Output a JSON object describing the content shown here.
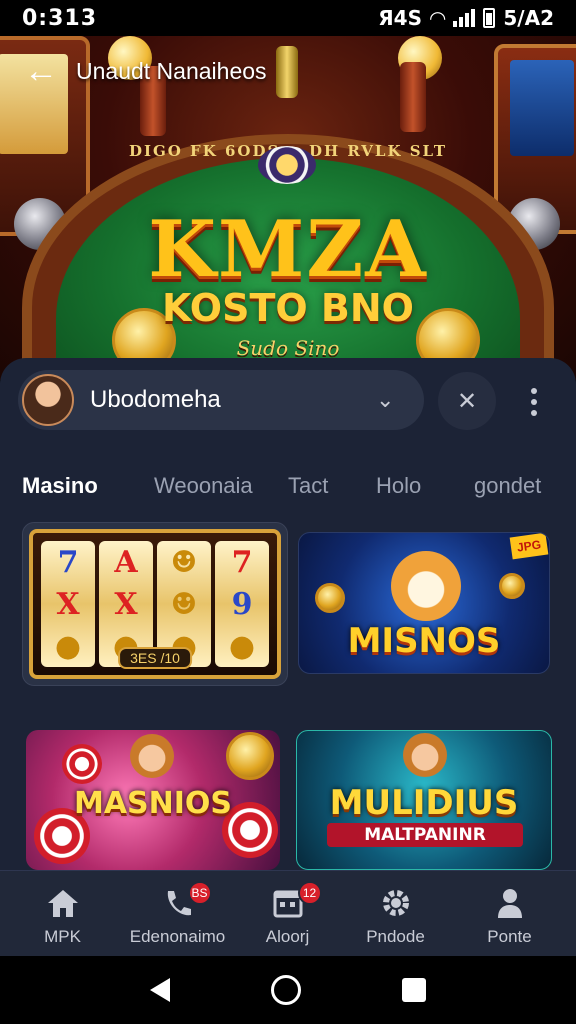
{
  "status_bar": {
    "time": "0:313",
    "right_text": "Я4Ѕ",
    "battery_text": "5/A2"
  },
  "header": {
    "title": "Unaudt Nanaiheos"
  },
  "hero": {
    "table_text": "DIGO FK 6ODS  ∨  DH RVLK SLT",
    "logo_main": "KMZA",
    "logo_sub": "KOSTO BNO",
    "logo_tag": "Sudo Sino"
  },
  "search": {
    "value": "Ubodomeha"
  },
  "tabs": [
    {
      "label": "Masino",
      "active": true
    },
    {
      "label": "Weoonaia",
      "active": false
    },
    {
      "label": "Tact",
      "active": false
    },
    {
      "label": "Holo",
      "active": false
    },
    {
      "label": "gondet",
      "active": false
    }
  ],
  "cards": {
    "slots": {
      "reels": [
        [
          "7",
          "X",
          ""
        ],
        [
          "A",
          "X",
          ""
        ],
        [
          "",
          "",
          ""
        ],
        [
          "7",
          "9",
          ""
        ]
      ],
      "label": "3ES /10"
    },
    "misnos": {
      "title": "MISNOS",
      "corner": "JPG"
    },
    "masnios": {
      "title": "MASNIOS"
    },
    "mulidius": {
      "title": "MULIDIUS",
      "subtitle": "MALTPANINR"
    }
  },
  "bottom_nav": [
    {
      "label": "MPK",
      "icon": "home-icon",
      "badge": ""
    },
    {
      "label": "Edenonaimo",
      "icon": "phone-icon",
      "badge": "BS"
    },
    {
      "label": "Aloorj",
      "icon": "calendar-icon",
      "badge": "12"
    },
    {
      "label": "Pndode",
      "icon": "gear-icon",
      "badge": ""
    },
    {
      "label": "Ponte",
      "icon": "person-icon",
      "badge": ""
    }
  ],
  "colors": {
    "sheet_bg": "#1c2336",
    "nav_bg": "#212839",
    "accent_gold": "#ffc21a",
    "badge_red": "#d8202a"
  }
}
